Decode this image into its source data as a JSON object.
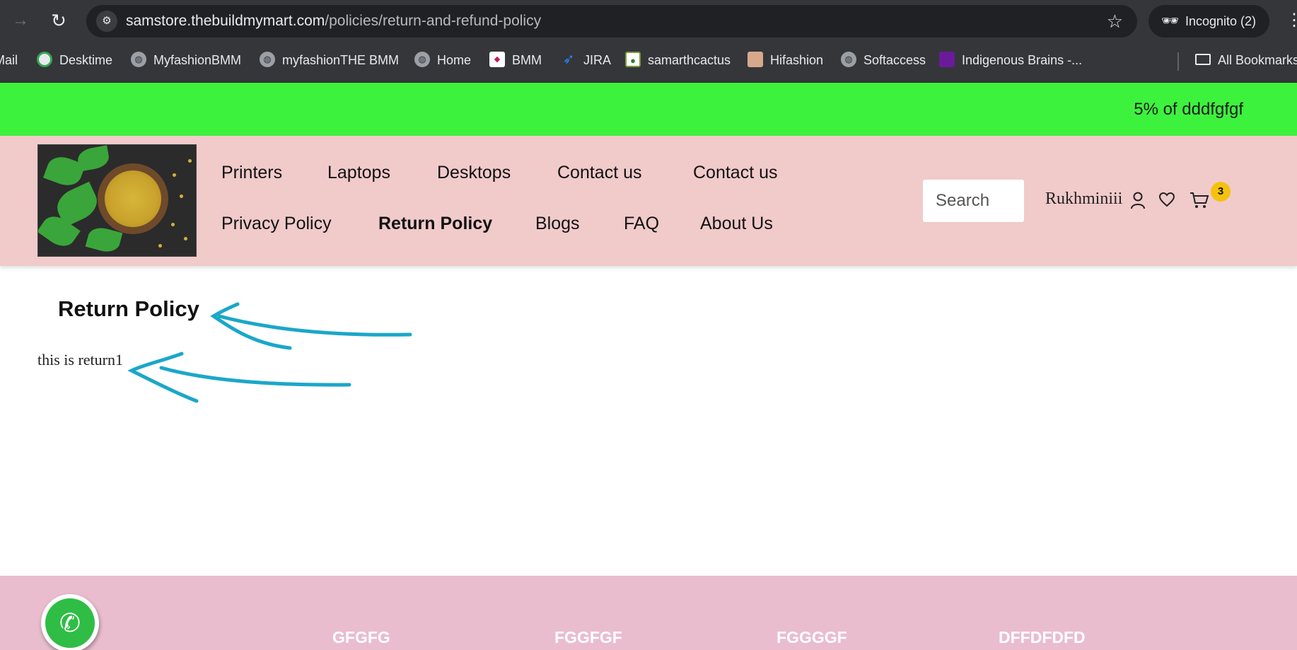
{
  "browser": {
    "url_host": "samstore.thebuildmymart.com",
    "url_path": "/policies/return-and-refund-policy",
    "incognito_label": "Incognito (2)",
    "bookmarks": [
      {
        "label": "Mail",
        "icon": "none"
      },
      {
        "label": "Desktime",
        "icon": "desktime-icon"
      },
      {
        "label": "MyfashionBMM",
        "icon": "globe-icon"
      },
      {
        "label": "myfashionTHE BMM",
        "icon": "globe-icon"
      },
      {
        "label": "Home",
        "icon": "globe-icon"
      },
      {
        "label": "BMM",
        "icon": "bmm-icon"
      },
      {
        "label": "JIRA",
        "icon": "jira-icon"
      },
      {
        "label": "samarthcactus",
        "icon": "cactus-icon"
      },
      {
        "label": "Hifashion",
        "icon": "hifashion-icon"
      },
      {
        "label": "Softaccess",
        "icon": "globe-icon"
      },
      {
        "label": "Indigenous Brains -...",
        "icon": "indigenous-icon"
      }
    ],
    "all_bookmarks_label": "All Bookmarks"
  },
  "announcement": {
    "text": "5% of dddfgfgf",
    "background": "#3df23d"
  },
  "header": {
    "background": "#f1caca",
    "nav": [
      {
        "label": "Printers",
        "active": false
      },
      {
        "label": "Laptops",
        "active": false
      },
      {
        "label": "Desktops",
        "active": false
      },
      {
        "label": "Contact us",
        "active": false
      },
      {
        "label": "Contact us",
        "active": false
      },
      {
        "label": "Privacy Policy",
        "active": false
      },
      {
        "label": "Return Policy",
        "active": true
      },
      {
        "label": "Blogs",
        "active": false
      },
      {
        "label": "FAQ",
        "active": false
      },
      {
        "label": "About Us",
        "active": false
      }
    ],
    "search_placeholder": "Search",
    "user_name": "Rukhminiii",
    "cart_count": "3",
    "cart_badge_color": "#f4c20d"
  },
  "content": {
    "title": "Return Policy",
    "body": "this is return1",
    "annotation_color": "#1aa7c9"
  },
  "footer": {
    "background": "#e9bdce",
    "headings": [
      "GFGFG",
      "FGGFGF",
      "FGGGGF",
      "DFFDFDFD"
    ]
  }
}
